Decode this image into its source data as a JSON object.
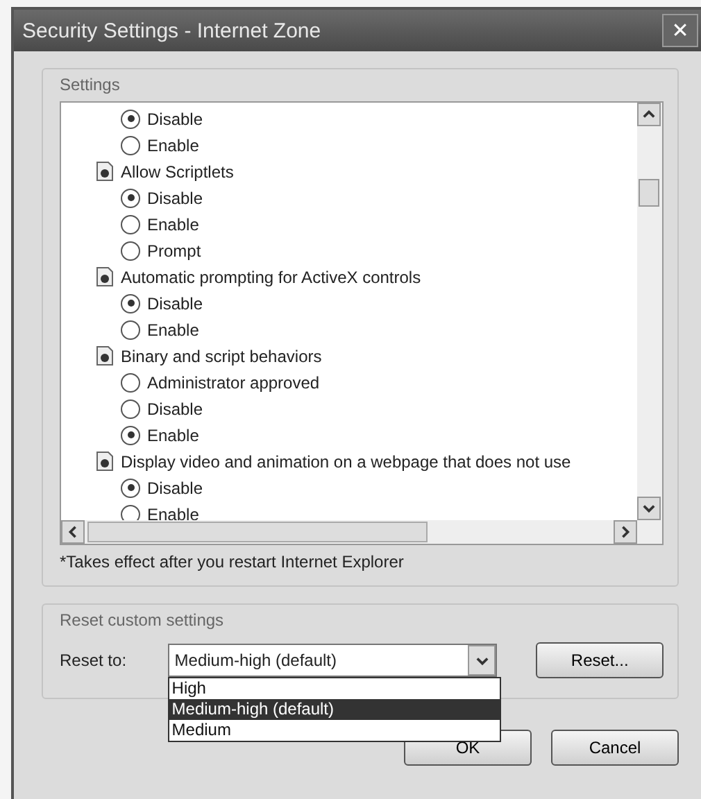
{
  "window": {
    "title": "Security Settings - Internet Zone",
    "close": "✕"
  },
  "settings": {
    "label": "Settings",
    "groups": [
      {
        "options": [
          {
            "label": "Disable",
            "selected": true
          },
          {
            "label": "Enable",
            "selected": false
          }
        ]
      },
      {
        "label": "Allow Scriptlets",
        "options": [
          {
            "label": "Disable",
            "selected": true
          },
          {
            "label": "Enable",
            "selected": false
          },
          {
            "label": "Prompt",
            "selected": false
          }
        ]
      },
      {
        "label": "Automatic prompting for ActiveX controls",
        "options": [
          {
            "label": "Disable",
            "selected": true
          },
          {
            "label": "Enable",
            "selected": false
          }
        ]
      },
      {
        "label": "Binary and script behaviors",
        "options": [
          {
            "label": "Administrator approved",
            "selected": false
          },
          {
            "label": "Disable",
            "selected": false
          },
          {
            "label": "Enable",
            "selected": true
          }
        ]
      },
      {
        "label": "Display video and animation on a webpage that does not use",
        "options": [
          {
            "label": "Disable",
            "selected": true
          },
          {
            "label": "Enable",
            "selected": false
          }
        ]
      }
    ],
    "note": "*Takes effect after you restart Internet Explorer"
  },
  "reset": {
    "label": "Reset custom settings",
    "field_label": "Reset to:",
    "value": "Medium-high (default)",
    "open": true,
    "options": [
      {
        "label": "High",
        "selected": false
      },
      {
        "label": "Medium-high (default)",
        "selected": true
      },
      {
        "label": "Medium",
        "selected": false
      }
    ],
    "button": "Reset..."
  },
  "buttons": [
    "OK",
    "Cancel"
  ]
}
